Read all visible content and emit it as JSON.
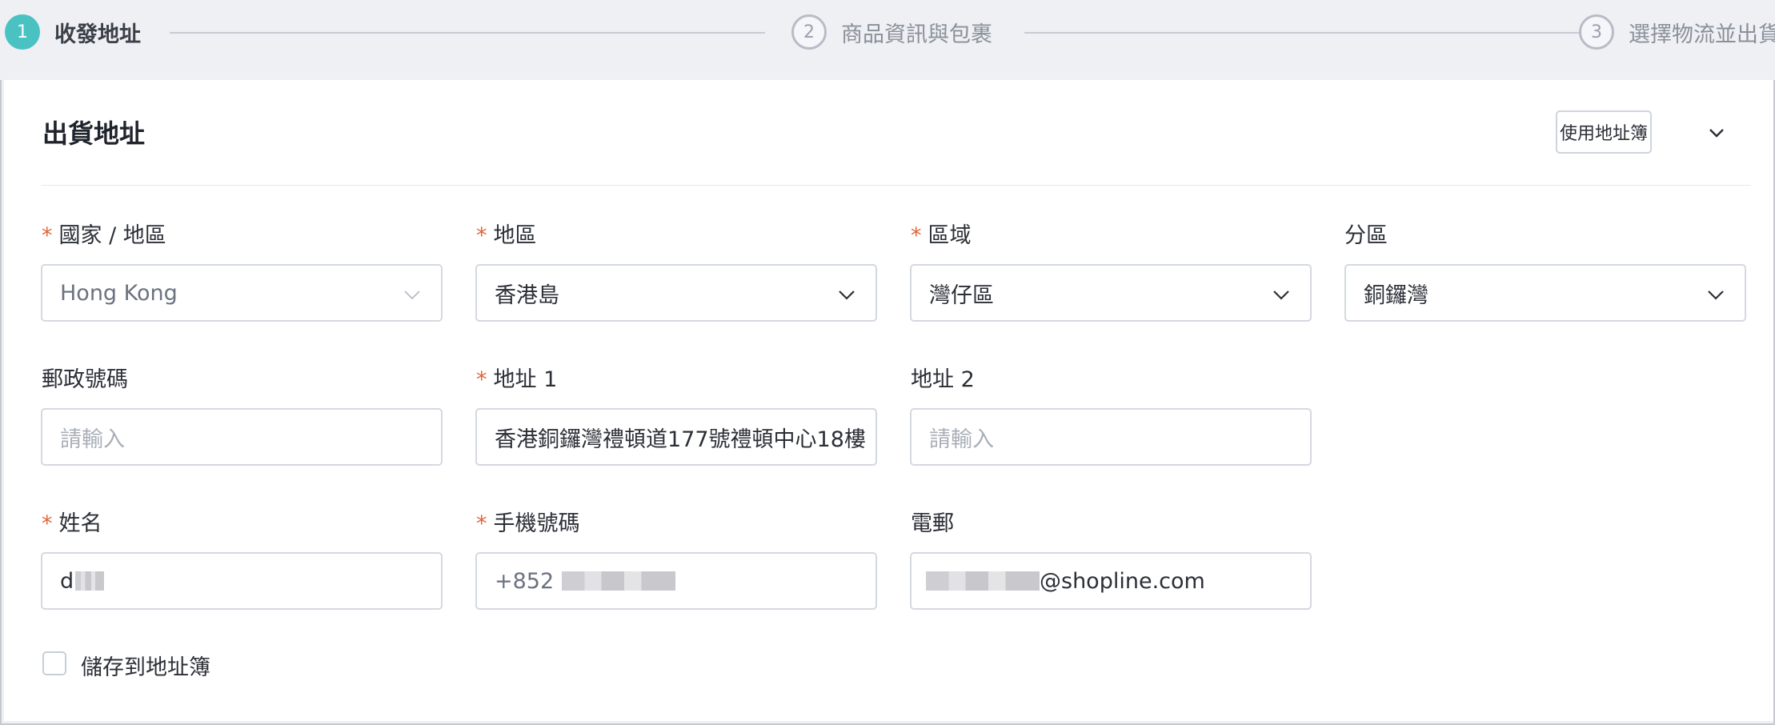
{
  "stepper": {
    "steps": [
      {
        "number": "1",
        "label": "收發地址"
      },
      {
        "number": "2",
        "label": "商品資訊與包裹"
      },
      {
        "number": "3",
        "label": "選擇物流並出貨"
      }
    ]
  },
  "section": {
    "title": "出貨地址",
    "address_book_button": "使用地址簿"
  },
  "fields": {
    "country": {
      "label": "國家 / 地區",
      "value": "Hong Kong"
    },
    "region": {
      "label": "地區",
      "value": "香港島"
    },
    "district": {
      "label": "區域",
      "value": "灣仔區"
    },
    "subdistrict": {
      "label": "分區",
      "value": "銅鑼灣"
    },
    "postal_code": {
      "label": "郵政號碼",
      "placeholder": "請輸入"
    },
    "address1": {
      "label": "地址 1",
      "value": "香港銅鑼灣禮頓道177號禮頓中心18樓"
    },
    "address2": {
      "label": "地址 2",
      "placeholder": "請輸入"
    },
    "name": {
      "label": "姓名",
      "value_visible": "d"
    },
    "phone": {
      "label": "手機號碼",
      "prefix": "+852"
    },
    "email": {
      "label": "電郵",
      "value_visible": "@shopline.com"
    }
  },
  "save_checkbox": {
    "label": "儲存到地址簿",
    "checked": false
  },
  "colors": {
    "accent": "#4ac2c2",
    "required": "#e0653c"
  }
}
